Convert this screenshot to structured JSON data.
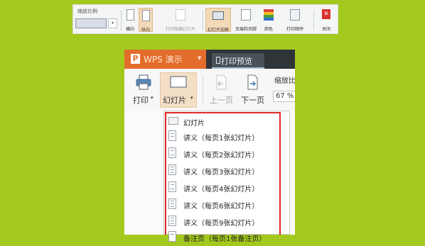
{
  "top_toolbar": {
    "zoom_label": "缩放比例",
    "buttons": [
      {
        "label": "横向",
        "icon": "portrait-icon"
      },
      {
        "label": "纵向",
        "icon": "landscape-icon"
      },
      {
        "label": "打印隐藏幻灯片",
        "icon": "print-hidden-slides-icon"
      },
      {
        "label": "幻灯片加框",
        "icon": "frame-slides-icon"
      },
      {
        "label": "页眉和页脚",
        "icon": "header-footer-icon"
      },
      {
        "label": "颜色",
        "icon": "color-icon"
      },
      {
        "label": "打印顺序",
        "icon": "print-order-icon"
      },
      {
        "label": "关闭",
        "icon": "close-icon"
      }
    ]
  },
  "window": {
    "app_name": "WPS 演示",
    "active_tab": "打印预览",
    "ribbon": {
      "print_label": "打印",
      "slides_label": "幻灯片",
      "prev_page_label": "上一页",
      "next_page_label": "下一页",
      "zoom_label": "缩放比",
      "zoom_value": "67 %"
    }
  },
  "dropdown": {
    "items": [
      {
        "label": "幻灯片",
        "icon": "slide-icon"
      },
      {
        "label": "讲义（每页1张幻灯片）",
        "icon": "handout-1-icon"
      },
      {
        "label": "讲义（每页2张幻灯片）",
        "icon": "handout-2-icon"
      },
      {
        "label": "讲义（每页3张幻灯片）",
        "icon": "handout-3-icon"
      },
      {
        "label": "讲义（每页4张幻灯片）",
        "icon": "handout-4-icon"
      },
      {
        "label": "讲义（每页6张幻灯片）",
        "icon": "handout-6-icon"
      },
      {
        "label": "讲义（每页9张幻灯片）",
        "icon": "handout-9-icon"
      },
      {
        "label": "备注页（每页1张备注页）",
        "icon": "notes-page-icon"
      }
    ]
  },
  "colors": {
    "background": "#a4c91e",
    "accent_orange": "#e36d2c",
    "highlight_red": "#dc2a2a",
    "titlebar_dark": "#2f3439"
  }
}
